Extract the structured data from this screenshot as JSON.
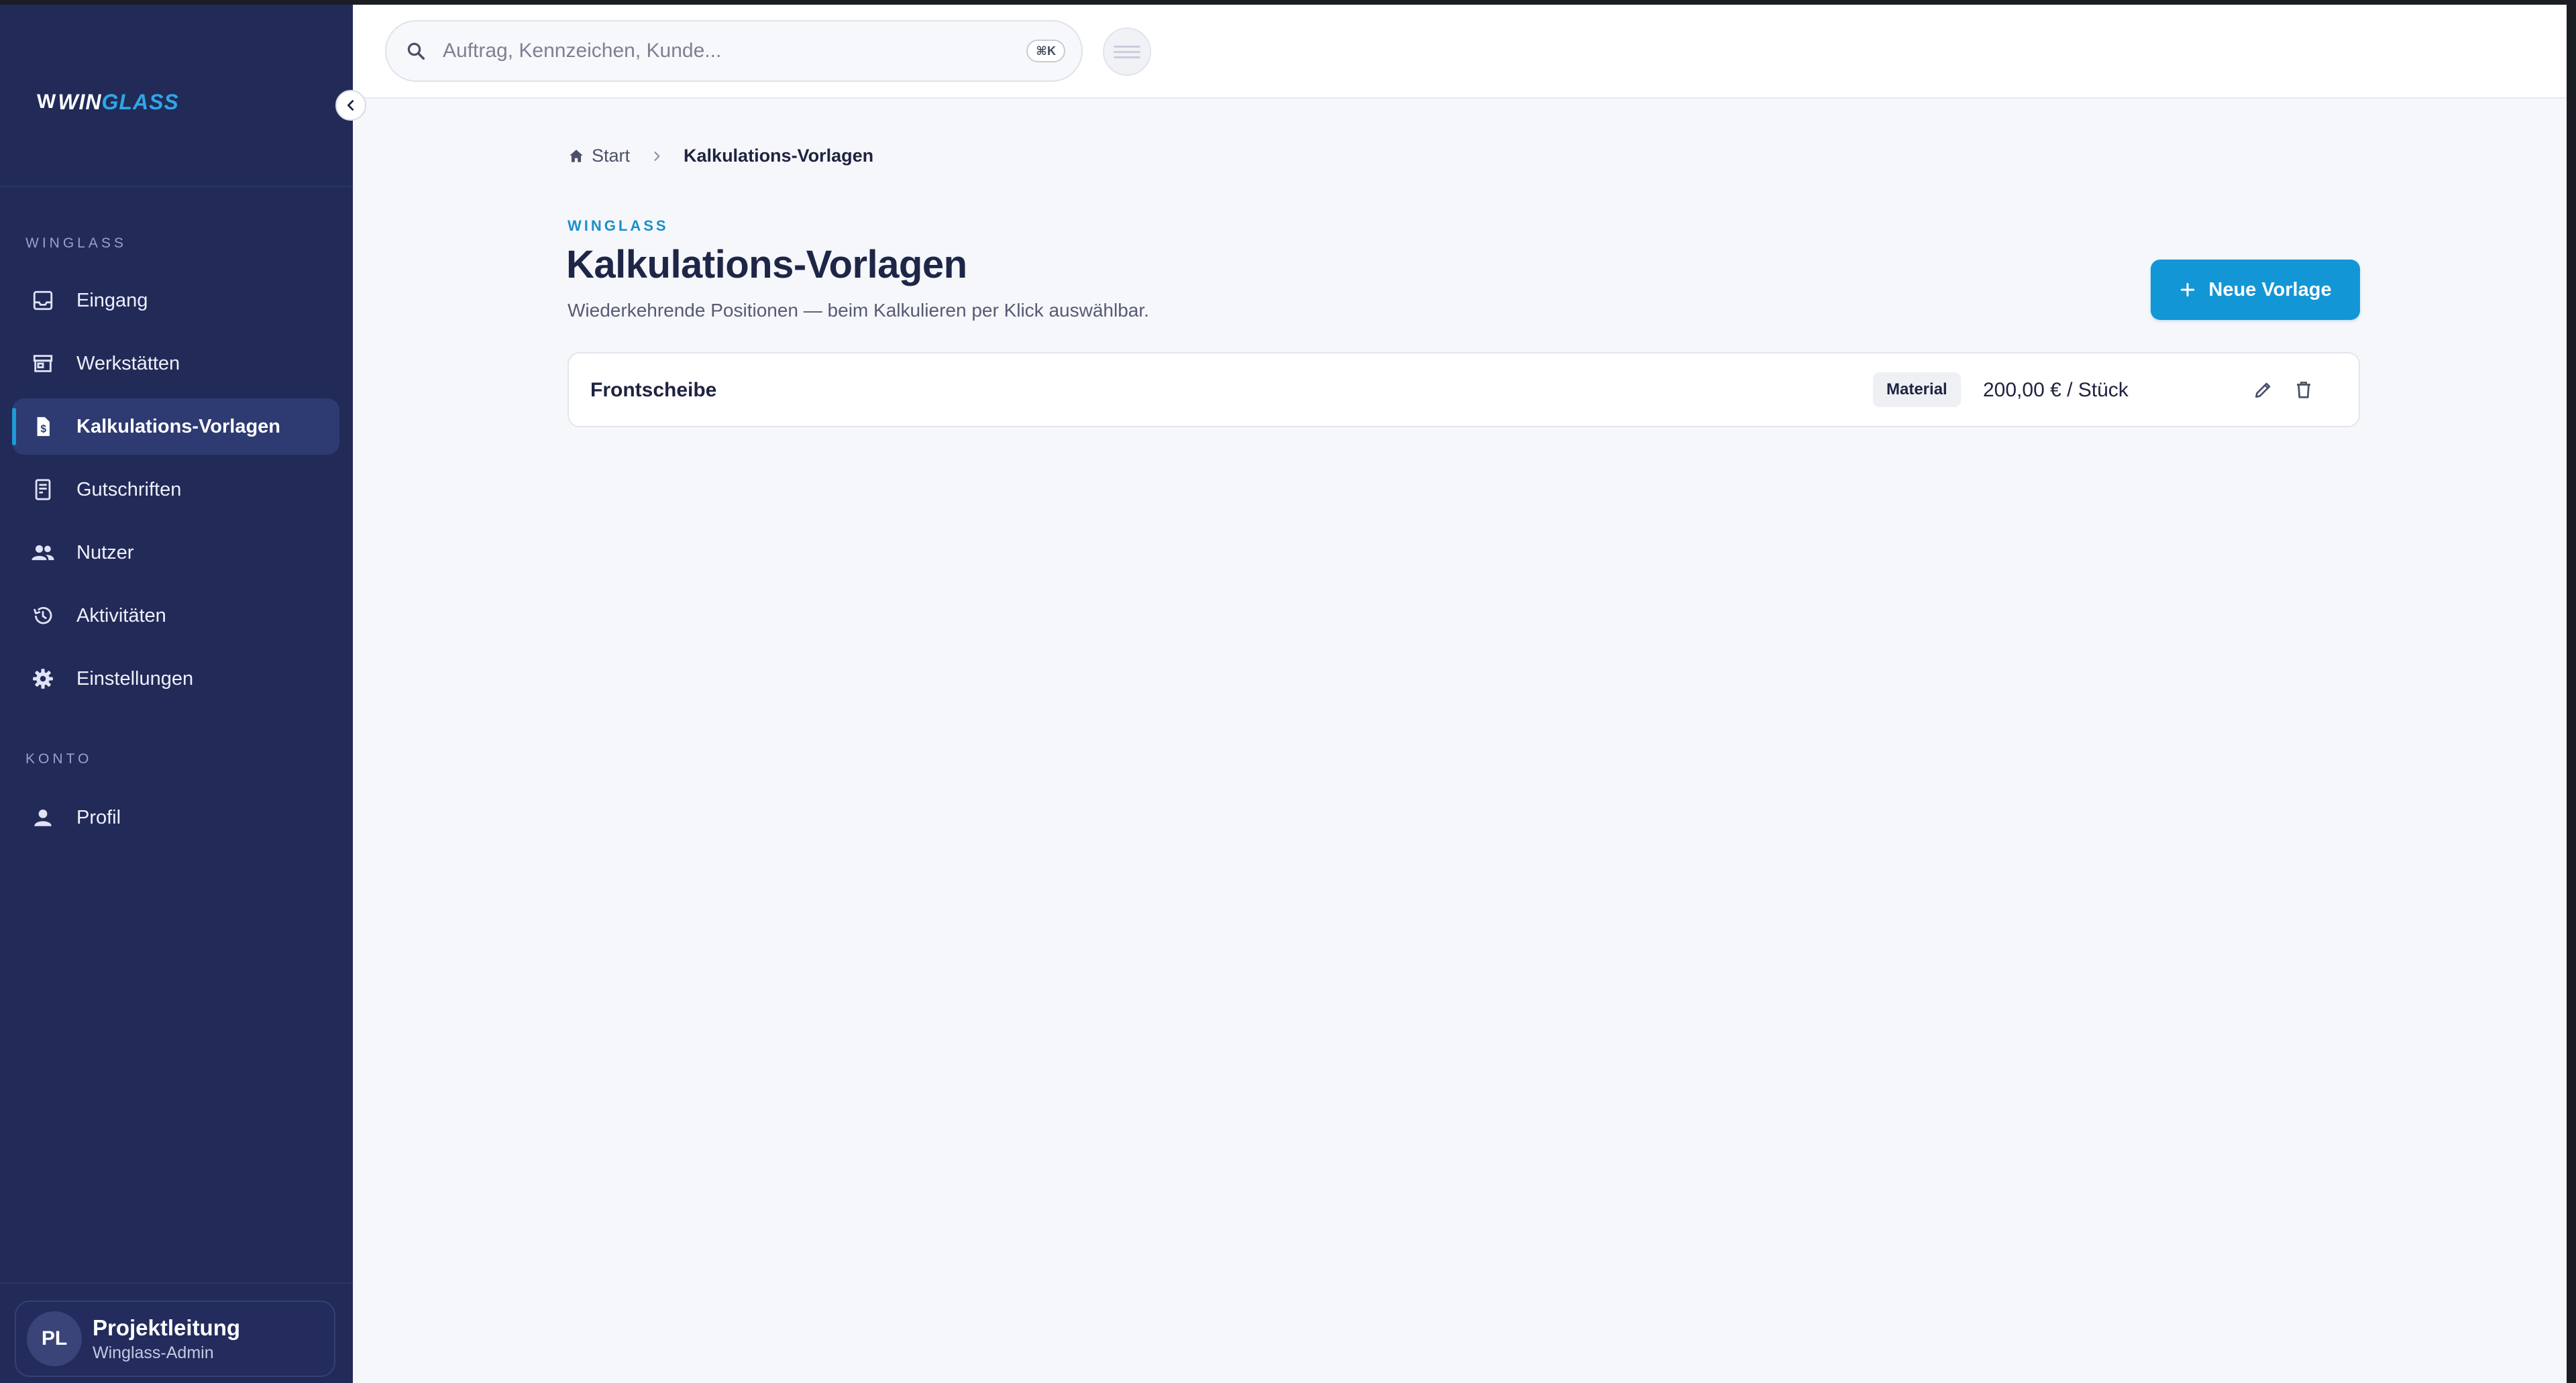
{
  "brand": {
    "logo_part_a": "WIN",
    "logo_part_b": "GLASS",
    "logo_mark": "W"
  },
  "sidebar": {
    "section_winglass": "WINGLASS",
    "section_konto": "KONTO",
    "items": [
      {
        "label": "Eingang",
        "icon": "inbox-icon"
      },
      {
        "label": "Werkstätten",
        "icon": "store-icon"
      },
      {
        "label": "Kalkulations-Vorlagen",
        "icon": "receipt-icon",
        "active": true
      },
      {
        "label": "Gutschriften",
        "icon": "credit-note-icon"
      },
      {
        "label": "Nutzer",
        "icon": "users-icon"
      },
      {
        "label": "Aktivitäten",
        "icon": "history-icon"
      },
      {
        "label": "Einstellungen",
        "icon": "gear-icon"
      }
    ],
    "konto_items": [
      {
        "label": "Profil",
        "icon": "person-icon"
      }
    ],
    "user": {
      "initials": "PL",
      "name": "Projektleitung",
      "role": "Winglass-Admin"
    }
  },
  "topbar": {
    "search_placeholder": "Auftrag, Kennzeichen, Kunde...",
    "shortcut": "⌘K"
  },
  "breadcrumb": {
    "home": "Start",
    "current": "Kalkulations-Vorlagen"
  },
  "page": {
    "eyebrow": "WINGLASS",
    "title": "Kalkulations-Vorlagen",
    "subtitle": "Wiederkehrende Positionen — beim Kalkulieren per Klick auswählbar.",
    "new_button": "Neue Vorlage"
  },
  "templates": [
    {
      "name": "Frontscheibe",
      "category": "Material",
      "price": "200,00 € / Stück"
    }
  ],
  "colors": {
    "sidebar_bg": "#222a58",
    "accent": "#1296d6",
    "active_item_bg": "#2e3a72",
    "page_bg": "#f6f7fb"
  }
}
